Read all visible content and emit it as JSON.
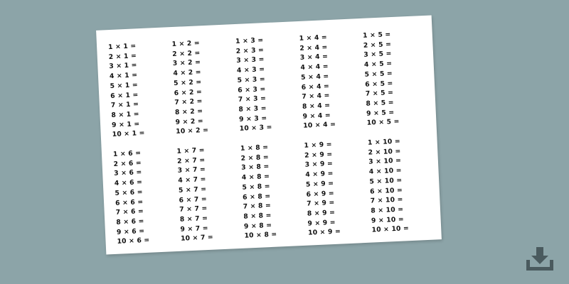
{
  "tables": [
    {
      "rows": [
        "1 × 1 =",
        "2 × 1 =",
        "3 × 1 =",
        "4 × 1 =",
        "5 × 1 =",
        "6 × 1 =",
        "7 × 1 =",
        "8 × 1 =",
        "9 × 1 =",
        "10 × 1 ="
      ]
    },
    {
      "rows": [
        "1 × 2 =",
        "2 × 2 =",
        "3 × 2 =",
        "4 × 2 =",
        "5 × 2 =",
        "6 × 2 =",
        "7 × 2 =",
        "8 × 2 =",
        "9 × 2 =",
        "10 × 2 ="
      ]
    },
    {
      "rows": [
        "1 × 3 =",
        "2 × 3 =",
        "3 × 3 =",
        "4 × 3 =",
        "5 × 3 =",
        "6 × 3 =",
        "7 × 3 =",
        "8 × 3 =",
        "9 × 3 =",
        "10 × 3 ="
      ]
    },
    {
      "rows": [
        "1 × 4 =",
        "2 × 4 =",
        "3 × 4 =",
        "4 × 4 =",
        "5 × 4 =",
        "6 × 4 =",
        "7 × 4 =",
        "8 × 4 =",
        "9 × 4 =",
        "10 × 4 ="
      ]
    },
    {
      "rows": [
        "1 × 5 =",
        "2 × 5 =",
        "3 × 5 =",
        "4 × 5 =",
        "5 × 5 =",
        "6 × 5 =",
        "7 × 5 =",
        "8 × 5 =",
        "9 × 5 =",
        "10 × 5 ="
      ]
    },
    {
      "rows": [
        "1 × 6 =",
        "2 × 6 =",
        "3 × 6 =",
        "4 × 6 =",
        "5 × 6 =",
        "6 × 6 =",
        "7 × 6 =",
        "8 × 6 =",
        "9 × 6 =",
        "10 × 6 ="
      ]
    },
    {
      "rows": [
        "1 × 7 =",
        "2 × 7 =",
        "3 × 7 =",
        "4 × 7 =",
        "5 × 7 =",
        "6 × 7 =",
        "7 × 7 =",
        "8 × 7 =",
        "9 × 7 =",
        "10 × 7 ="
      ]
    },
    {
      "rows": [
        "1 × 8 =",
        "2 × 8 =",
        "3 × 8 =",
        "4 × 8 =",
        "5 × 8 =",
        "6 × 8 =",
        "7 × 8 =",
        "8 × 8 =",
        "9 × 8 =",
        "10 × 8 ="
      ]
    },
    {
      "rows": [
        "1 × 9 =",
        "2 × 9 =",
        "3 × 9 =",
        "4 × 9 =",
        "5 × 9 =",
        "6 × 9 =",
        "7 × 9 =",
        "8 × 9 =",
        "9 × 9 =",
        "10 × 9 ="
      ]
    },
    {
      "rows": [
        "1 × 10 =",
        "2 × 10 =",
        "3 × 10 =",
        "4 × 10 =",
        "5 × 10 =",
        "6 × 10 =",
        "7 × 10 =",
        "8 × 10 =",
        "9 × 10 =",
        "10 × 10 ="
      ]
    }
  ],
  "download": {
    "icon": "download-icon",
    "color": "#4a5a5e"
  },
  "colors": {
    "background": "#8ca4a8",
    "sheet": "#ffffff",
    "text": "#111111"
  }
}
